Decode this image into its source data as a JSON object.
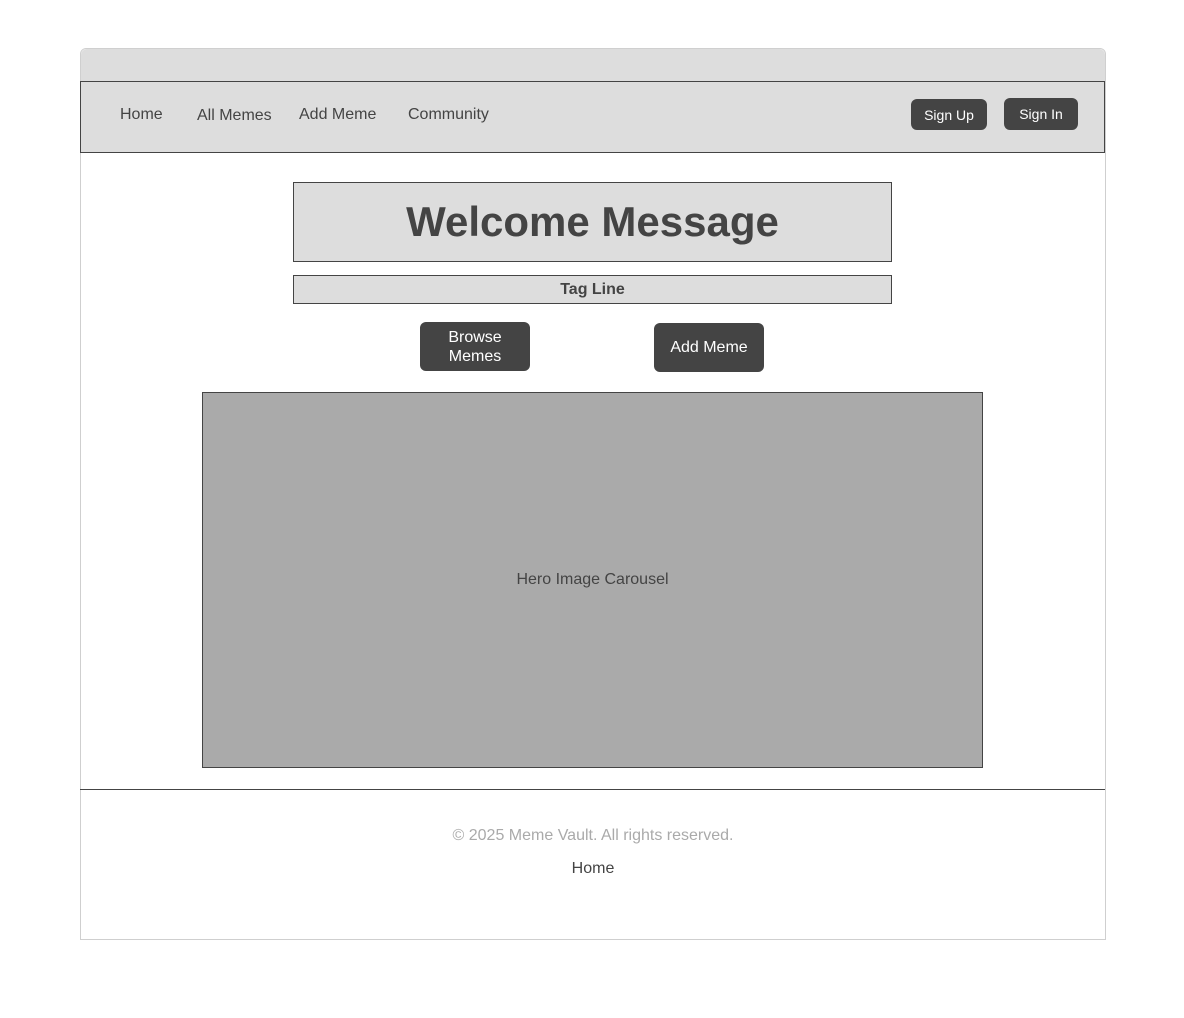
{
  "nav": {
    "links": [
      "Home",
      "All Memes",
      "Add Meme",
      "Community"
    ],
    "sign_up": "Sign Up",
    "sign_in": "Sign In"
  },
  "hero": {
    "welcome": "Welcome Message",
    "tagline": "Tag Line",
    "browse_button": "Browse Memes",
    "add_button": "Add Meme",
    "carousel_label": "Hero Image Carousel"
  },
  "footer": {
    "copyright": "© 2025 Meme Vault. All rights reserved.",
    "home_link": "Home"
  },
  "colors": {
    "dark": "#444444",
    "panel": "#dddddd",
    "carousel": "#aaaaaa",
    "muted_text": "#aaaaaa"
  }
}
